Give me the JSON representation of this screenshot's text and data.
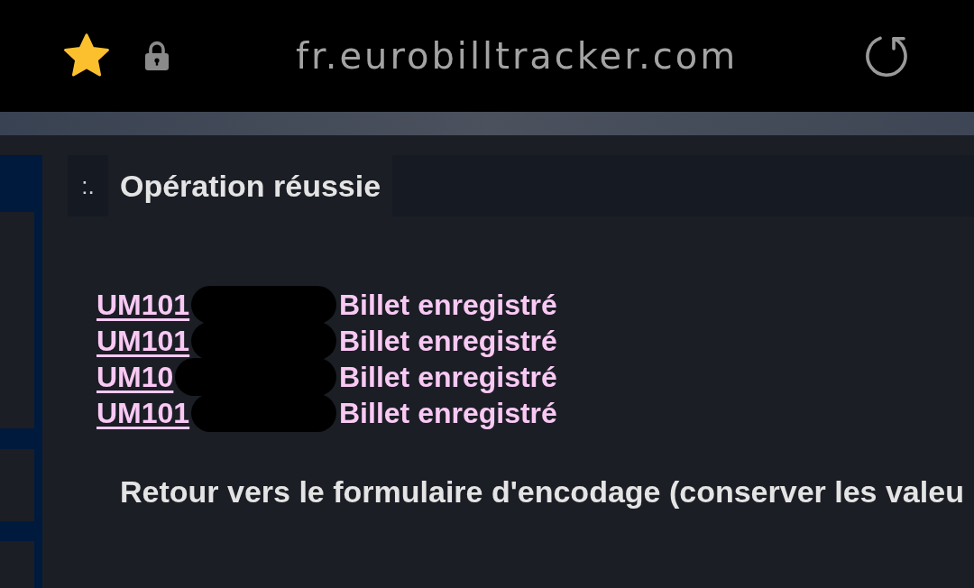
{
  "browser_bar": {
    "url": "fr.eurobilltracker.com",
    "bookmarked": true
  },
  "header": {
    "marker": ":.",
    "title": "Opération réussie"
  },
  "results": [
    {
      "serial": "UM101",
      "status": "Billet enregistré",
      "redacted": true
    },
    {
      "serial": "UM101",
      "status": "Billet enregistré",
      "redacted": true
    },
    {
      "serial": "UM10",
      "status": "Billet enregistré",
      "redacted": true
    },
    {
      "serial": "UM101",
      "status": "Billet enregistré",
      "redacted": true
    }
  ],
  "return_link": "Retour vers le formulaire d'encodage (conserver les valeu"
}
